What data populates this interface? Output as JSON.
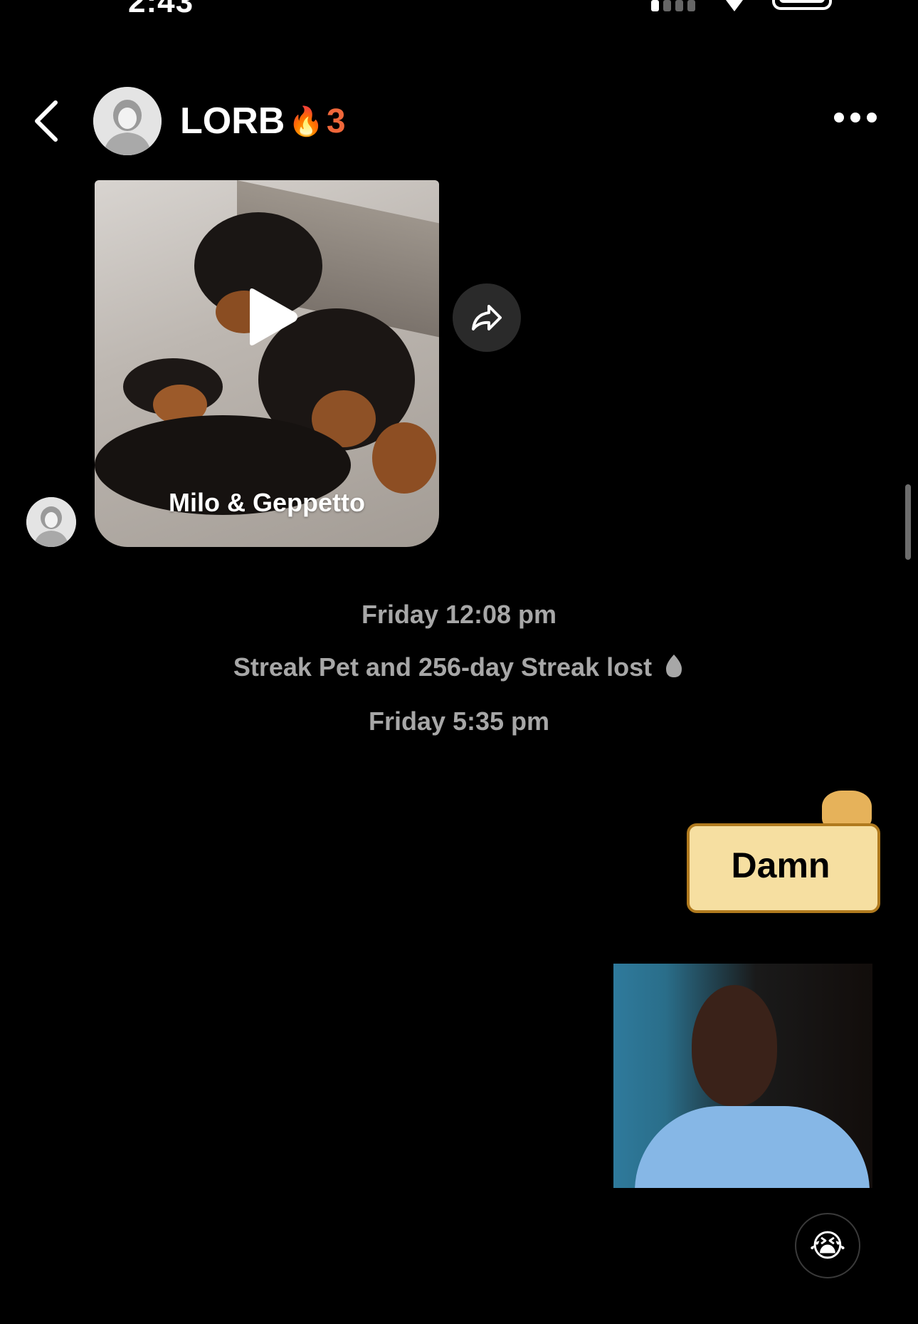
{
  "status_bar": {
    "time": "2:43"
  },
  "header": {
    "contact_name": "LORB",
    "streak_emoji": "🔥",
    "streak_count": "3"
  },
  "messages": {
    "video_caption": "Milo & Geppetto",
    "timestamp_1": "Friday 12:08 pm",
    "streak_notice": "Streak Pet and 256-day Streak lost",
    "timestamp_2": "Friday 5:35 pm",
    "sticker_text": "Damn",
    "reaction_emoji": "😭"
  },
  "colors": {
    "streak_accent": "#f0673a",
    "system_text": "#a7a7a7",
    "background": "#000000"
  },
  "icons": [
    "back-chevron-icon",
    "more-options-icon",
    "play-icon",
    "share-icon",
    "gray-flame-icon"
  ]
}
